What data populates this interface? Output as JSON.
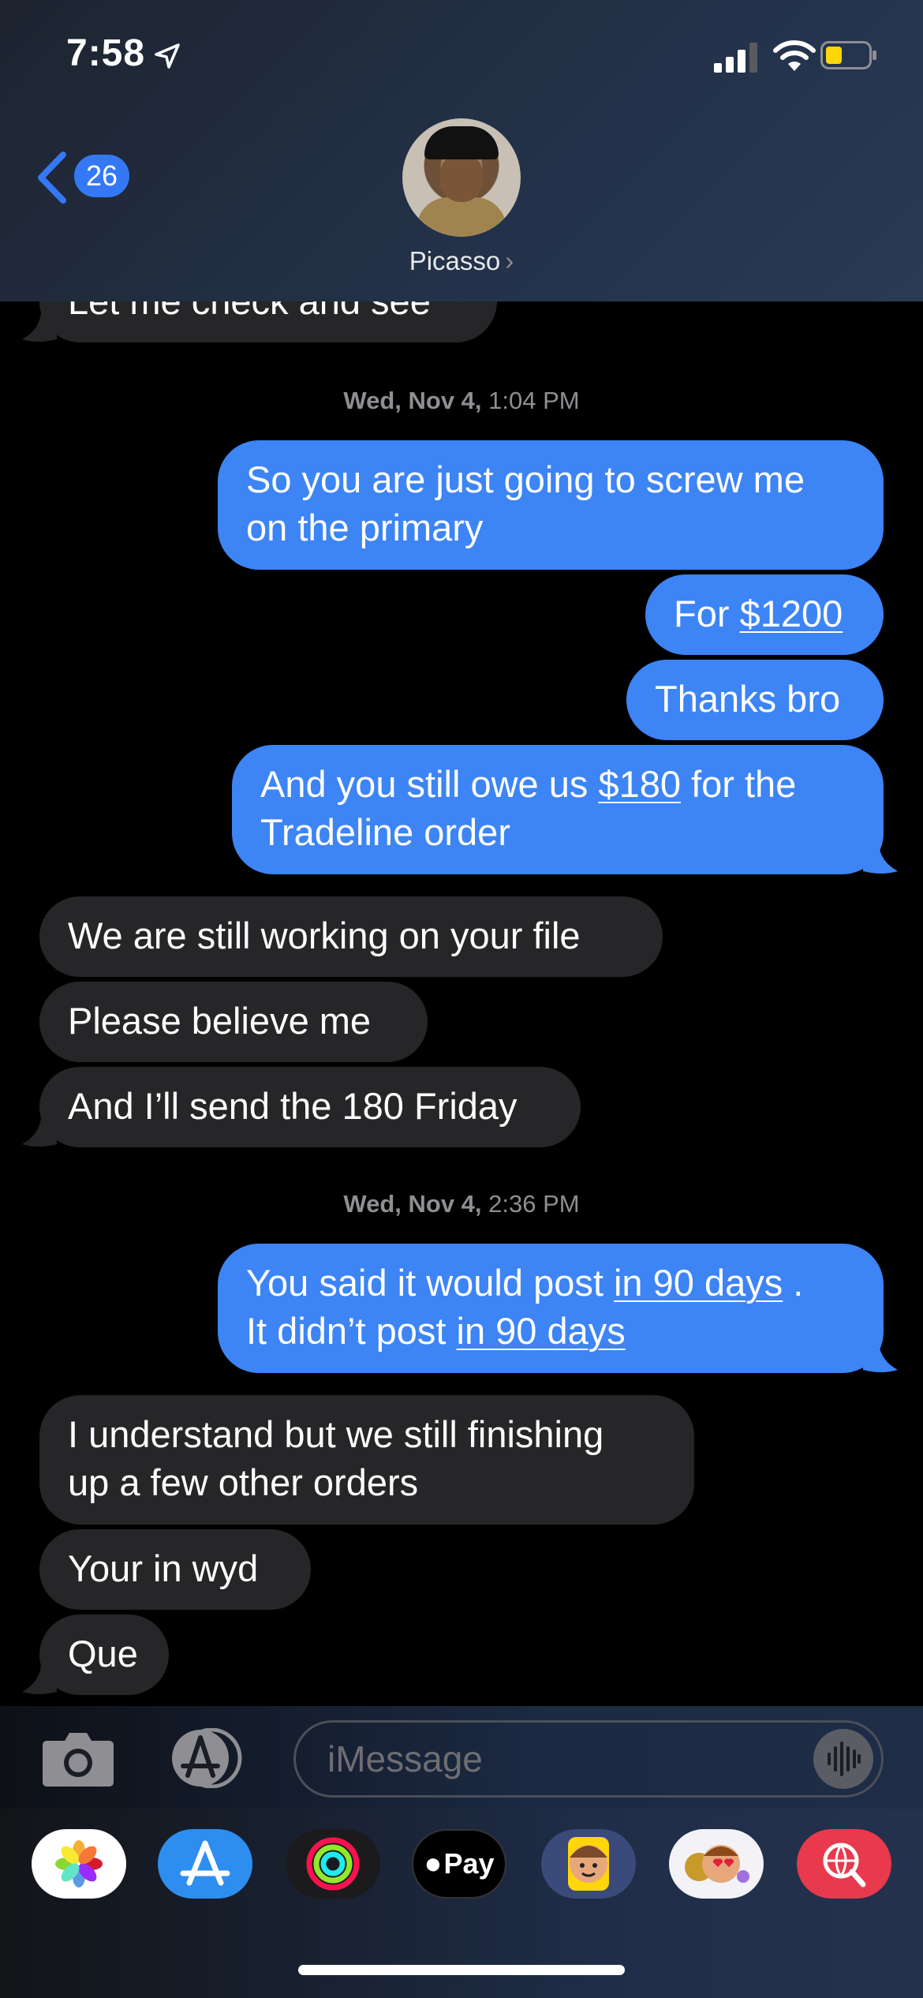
{
  "status_bar": {
    "time": "7:58"
  },
  "header": {
    "back_count": "26",
    "contact_name": "Picasso",
    "name_chevron": "›"
  },
  "conversation": {
    "clipped_message": "Let me check and see",
    "stamp1": {
      "day": "Wed, Nov 4,",
      "time": "1:04 PM"
    },
    "group1_out": [
      {
        "text": [
          "So you are just going to screw me",
          "on the primary"
        ]
      },
      {
        "prefix": "For ",
        "link": "$1200"
      },
      {
        "text": [
          "Thanks bro"
        ]
      },
      {
        "line1_prefix": "And you still owe us ",
        "line1_link": "$180",
        "line1_suffix": " for the",
        "line2": "Tradeline order"
      }
    ],
    "group1_in": [
      "We are still working on your file",
      "Please believe me",
      "And I’ll send the 180 Friday"
    ],
    "stamp2": {
      "day": "Wed, Nov 4,",
      "time": "2:36 PM"
    },
    "group2_out": {
      "line1_prefix": "You said it would post ",
      "line1_link": "in 90 days",
      "line1_suffix": " .",
      "line2_prefix": "It didn’t post ",
      "line2_link": "in 90 days"
    },
    "group2_in": [
      [
        "I understand but we still finishing",
        "up a few other orders"
      ],
      [
        "Your in wyd"
      ],
      [
        "Que"
      ]
    ]
  },
  "input": {
    "placeholder": "iMessage"
  },
  "drawer": {
    "apps": [
      "photos-icon",
      "app-store-icon",
      "activity-icon",
      "apple-pay-icon",
      "memoji-icon",
      "animoji-stickers-icon",
      "web-search-icon"
    ],
    "apple_pay_label": "Pay"
  },
  "colors": {
    "outgoing": "#3d84f5",
    "incoming": "#262628",
    "badge": "#3478f6"
  }
}
